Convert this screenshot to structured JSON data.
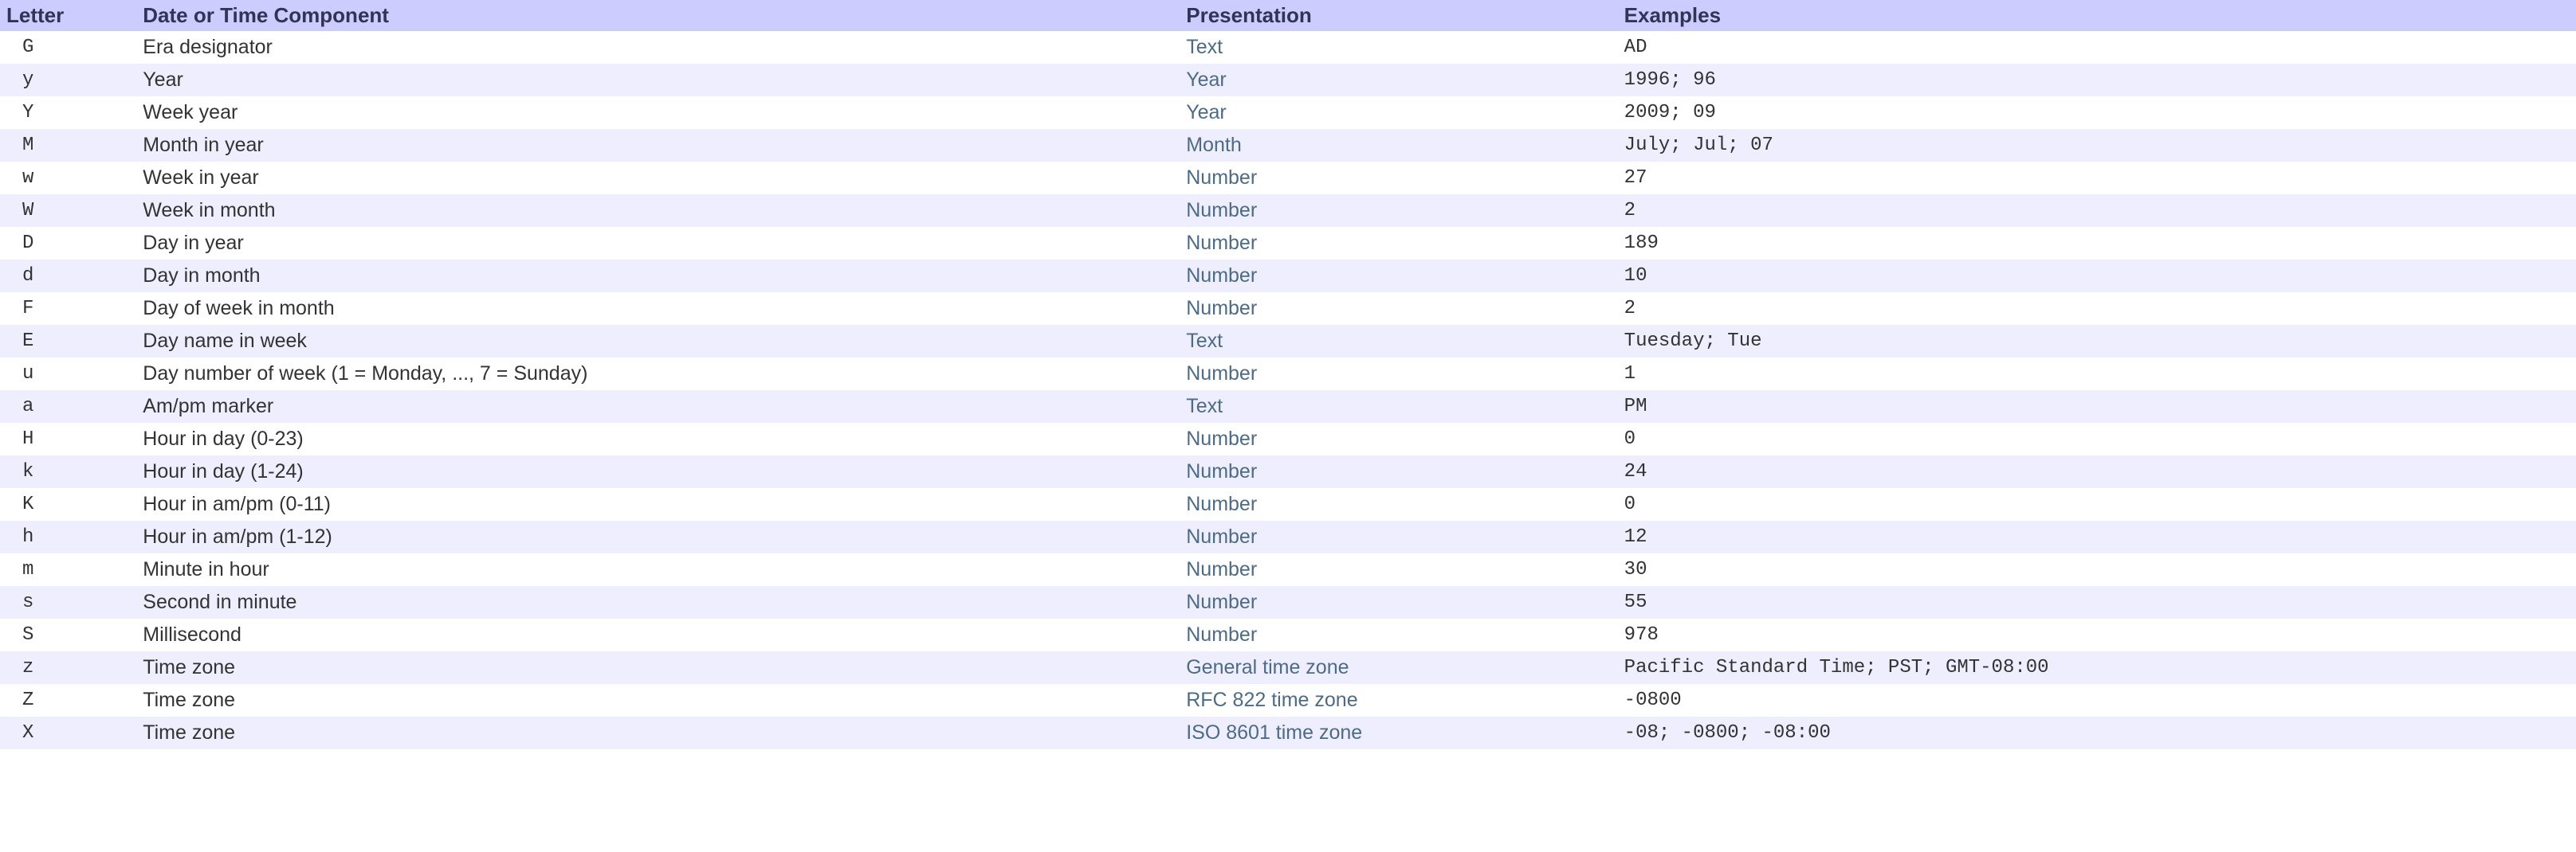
{
  "headers": {
    "letter": "Letter",
    "component": "Date or Time Component",
    "presentation": "Presentation",
    "examples": "Examples"
  },
  "rows": [
    {
      "letter": "G",
      "component": "Era designator",
      "presentation": "Text",
      "examples": "AD"
    },
    {
      "letter": "y",
      "component": "Year",
      "presentation": "Year",
      "examples": "1996; 96"
    },
    {
      "letter": "Y",
      "component": "Week year",
      "presentation": "Year",
      "examples": "2009; 09"
    },
    {
      "letter": "M",
      "component": "Month in year",
      "presentation": "Month",
      "examples": "July; Jul; 07"
    },
    {
      "letter": "w",
      "component": "Week in year",
      "presentation": "Number",
      "examples": "27"
    },
    {
      "letter": "W",
      "component": "Week in month",
      "presentation": "Number",
      "examples": "2"
    },
    {
      "letter": "D",
      "component": "Day in year",
      "presentation": "Number",
      "examples": "189"
    },
    {
      "letter": "d",
      "component": "Day in month",
      "presentation": "Number",
      "examples": "10"
    },
    {
      "letter": "F",
      "component": "Day of week in month",
      "presentation": "Number",
      "examples": "2"
    },
    {
      "letter": "E",
      "component": "Day name in week",
      "presentation": "Text",
      "examples": "Tuesday; Tue"
    },
    {
      "letter": "u",
      "component": "Day number of week (1 = Monday, ..., 7 = Sunday)",
      "presentation": "Number",
      "examples": "1"
    },
    {
      "letter": "a",
      "component": "Am/pm marker",
      "presentation": "Text",
      "examples": "PM"
    },
    {
      "letter": "H",
      "component": "Hour in day (0-23)",
      "presentation": "Number",
      "examples": "0"
    },
    {
      "letter": "k",
      "component": "Hour in day (1-24)",
      "presentation": "Number",
      "examples": "24"
    },
    {
      "letter": "K",
      "component": "Hour in am/pm (0-11)",
      "presentation": "Number",
      "examples": "0"
    },
    {
      "letter": "h",
      "component": "Hour in am/pm (1-12)",
      "presentation": "Number",
      "examples": "12"
    },
    {
      "letter": "m",
      "component": "Minute in hour",
      "presentation": "Number",
      "examples": "30"
    },
    {
      "letter": "s",
      "component": "Second in minute",
      "presentation": "Number",
      "examples": "55"
    },
    {
      "letter": "S",
      "component": "Millisecond",
      "presentation": "Number",
      "examples": "978"
    },
    {
      "letter": "z",
      "component": "Time zone",
      "presentation": "General time zone",
      "examples": "Pacific Standard Time; PST; GMT-08:00"
    },
    {
      "letter": "Z",
      "component": "Time zone",
      "presentation": "RFC 822 time zone",
      "examples": "-0800"
    },
    {
      "letter": "X",
      "component": "Time zone",
      "presentation": "ISO 8601 time zone",
      "examples": "-08; -0800; -08:00"
    }
  ]
}
